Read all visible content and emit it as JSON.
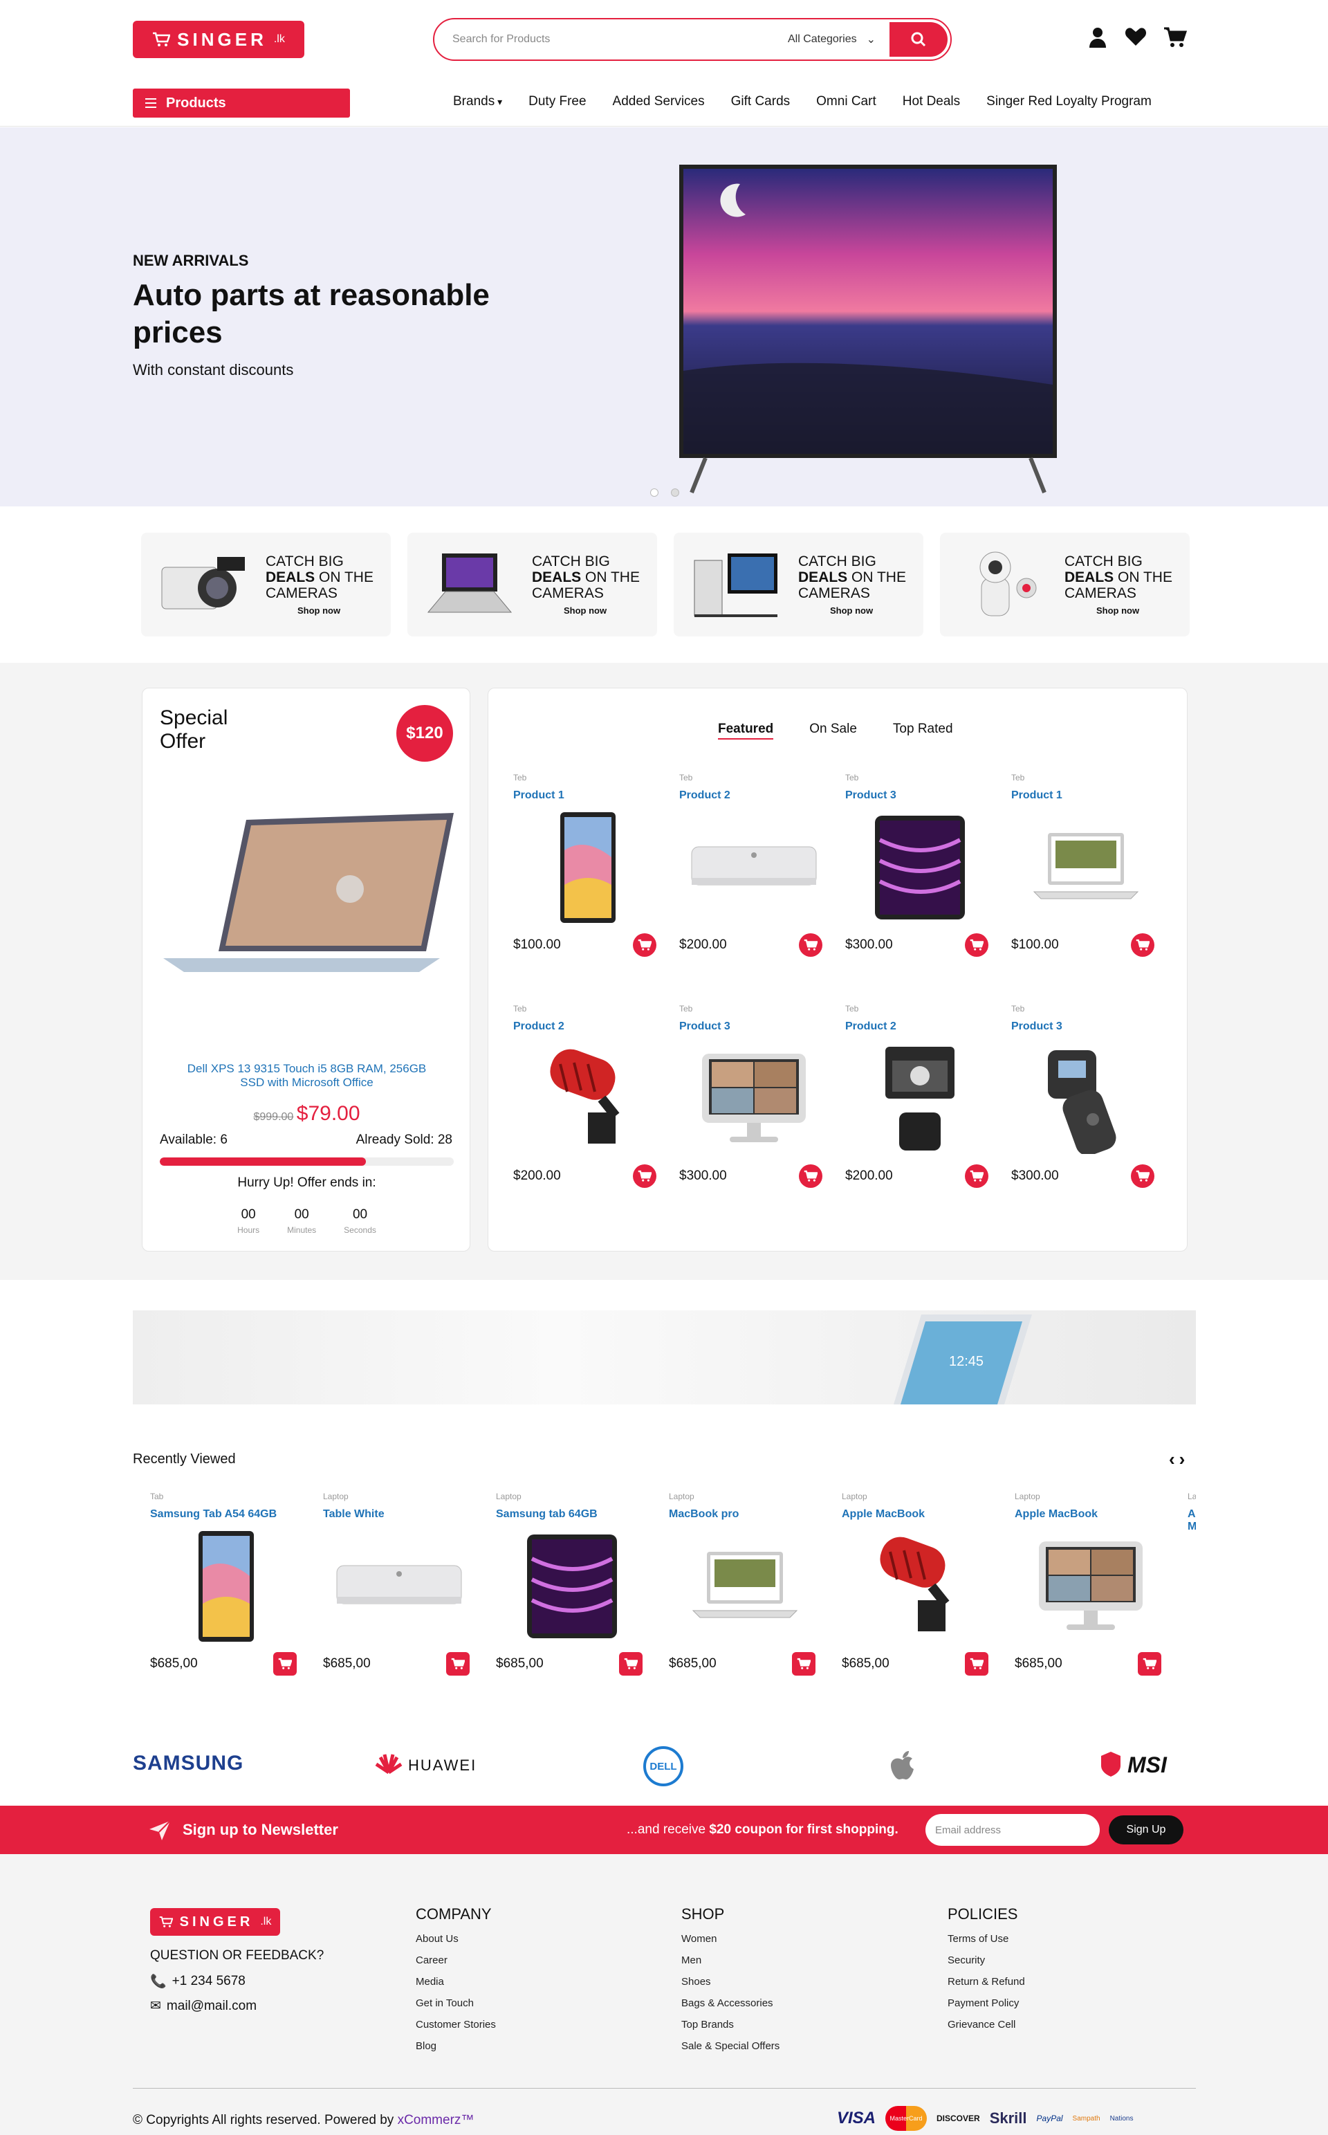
{
  "header": {
    "logo_text": "SINGER",
    "logo_suffix": ".lk",
    "search_placeholder": "Search for Products",
    "category": "All Categories",
    "icons": [
      "user-icon",
      "heart-icon",
      "cart-icon"
    ]
  },
  "nav": {
    "products_label": "Products",
    "links": [
      "Brands",
      "Duty Free",
      "Added Services",
      "Gift Cards",
      "Omni Cart",
      "Hot Deals",
      "Singer Red Loyalty Program"
    ]
  },
  "hero": {
    "eyebrow": "NEW ARRIVALS",
    "title": "Auto parts at reasonable prices",
    "subtitle": "With constant discounts"
  },
  "promo_cards": [
    {
      "l1": "CATCH BIG",
      "l2b": "DEALS",
      "l2": " ON THE",
      "l3": "CAMERAS",
      "shop": "Shop now"
    },
    {
      "l1": "CATCH BIG",
      "l2b": "DEALS",
      "l2": " ON THE",
      "l3": "CAMERAS",
      "shop": "Shop now"
    },
    {
      "l1": "CATCH BIG",
      "l2b": "DEALS",
      "l2": " ON THE",
      "l3": "CAMERAS",
      "shop": "Shop now"
    },
    {
      "l1": "CATCH BIG",
      "l2b": "DEALS",
      "l2": " ON THE",
      "l3": "CAMERAS",
      "shop": "Shop now"
    }
  ],
  "special": {
    "title1": "Special",
    "title2": "Offer",
    "badge": "$120",
    "product": "Dell XPS 13 9315 Touch i5 8GB RAM, 256GB SSD with Microsoft Office",
    "old_price": "$999.00",
    "price": "$79.00",
    "available": "Available: 6",
    "sold": "Already Sold: 28",
    "sold_fraction": 0.7,
    "hurry": "Hurry Up! Offer ends in:",
    "hours": "00",
    "minutes": "00",
    "seconds": "00",
    "hours_label": "Hours",
    "minutes_label": "Minutes",
    "seconds_label": "Seconds"
  },
  "tabs": [
    "Featured",
    "On Sale",
    "Top Rated"
  ],
  "products": [
    {
      "cat": "Teb",
      "name": "Product 1",
      "price": "$100.00"
    },
    {
      "cat": "Teb",
      "name": "Product 2",
      "price": "$200.00"
    },
    {
      "cat": "Teb",
      "name": "Product 3",
      "price": "$300.00"
    },
    {
      "cat": "Teb",
      "name": "Product 1",
      "price": "$100.00"
    },
    {
      "cat": "Teb",
      "name": "Product 2",
      "price": "$200.00"
    },
    {
      "cat": "Teb",
      "name": "Product 3",
      "price": "$300.00"
    },
    {
      "cat": "Teb",
      "name": "Product 2",
      "price": "$200.00"
    },
    {
      "cat": "Teb",
      "name": "Product 3",
      "price": "$300.00"
    }
  ],
  "recent": {
    "title": "Recently Viewed",
    "items": [
      {
        "cat": "Tab",
        "name": "Samsung Tab A54 64GB",
        "price": "$685,00"
      },
      {
        "cat": "Laptop",
        "name": "Table White",
        "price": "$685,00"
      },
      {
        "cat": "Laptop",
        "name": "Samsung tab 64GB",
        "price": "$685,00"
      },
      {
        "cat": "Laptop",
        "name": "MacBook pro",
        "price": "$685,00"
      },
      {
        "cat": "Laptop",
        "name": "Apple MacBook",
        "price": "$685,00"
      },
      {
        "cat": "Laptop",
        "name": "Apple MacBook",
        "price": "$685,00"
      }
    ]
  },
  "brands": [
    "SAMSUNG",
    "HUAWEI",
    "DELL",
    "MSI"
  ],
  "newsletter": {
    "title": "Sign up to Newsletter",
    "pre": "...and receive ",
    "bold": "$20 coupon for first shopping.",
    "placeholder": "Email address",
    "button": "Sign Up"
  },
  "footer": {
    "question": "QUESTION OR FEEDBACK?",
    "phone": "+1 234 5678",
    "email": "mail@mail.com",
    "company": {
      "title": "COMPANY",
      "links": [
        "About Us",
        "Career",
        "Media",
        "Get in Touch",
        "Customer Stories",
        "Blog"
      ]
    },
    "shop": {
      "title": "SHOP",
      "links": [
        "Women",
        "Men",
        "Shoes",
        "Bags & Accessories",
        "Top Brands",
        "Sale & Special Offers"
      ]
    },
    "policies": {
      "title": "POLICIES",
      "links": [
        "Terms of Use",
        "Security",
        "Return & Refund",
        "Payment Policy",
        "Grievance Cell"
      ]
    },
    "copyright": "© Copyrights All rights reserved. Powered by ",
    "powered": "xCommerz™",
    "payments": [
      "VISA",
      "MasterCard",
      "DISCOVER",
      "Skrill",
      "PayPal",
      "Sampath",
      "Nations"
    ]
  },
  "colors": {
    "brand": "#e4203f",
    "link": "#1f73b7"
  }
}
